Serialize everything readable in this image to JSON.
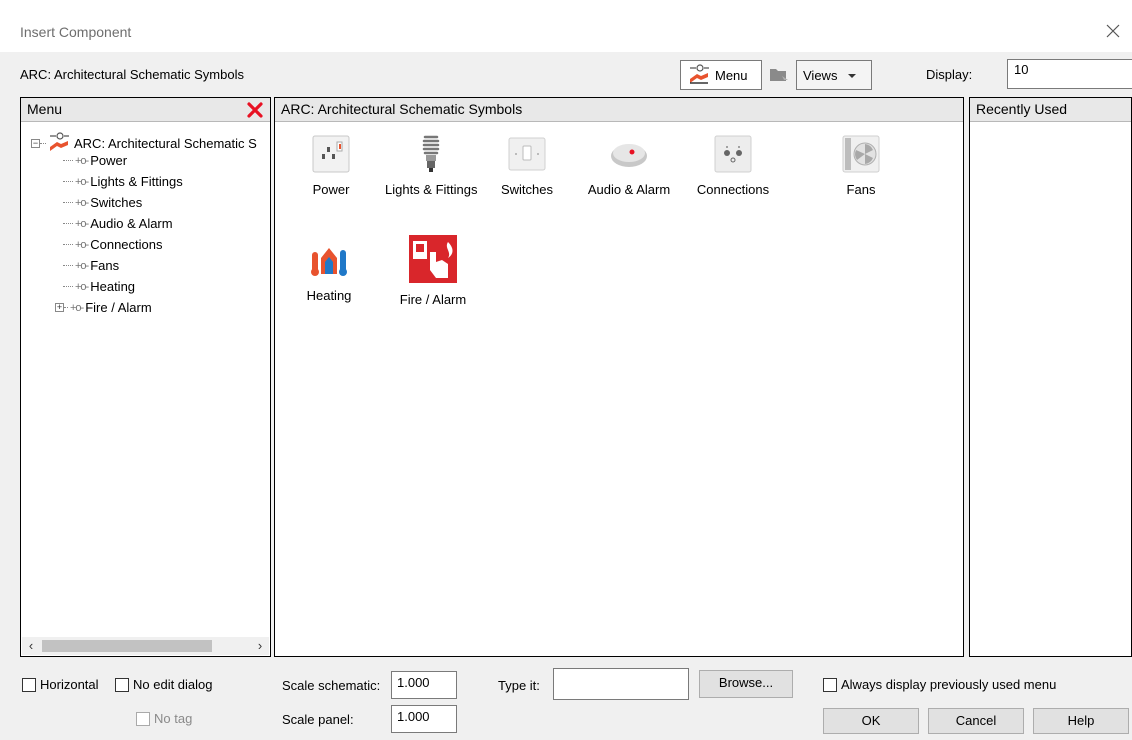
{
  "window": {
    "title": "Insert Component"
  },
  "header": {
    "library_label": "ARC: Architectural Schematic Symbols",
    "menu_button": "Menu",
    "views_button": "Views",
    "display_label": "Display:",
    "display_value": "10"
  },
  "left_panel": {
    "title": "Menu",
    "root_label": "ARC: Architectural Schematic S",
    "items": [
      {
        "label": "Power"
      },
      {
        "label": "Lights & Fittings"
      },
      {
        "label": "Switches"
      },
      {
        "label": "Audio & Alarm"
      },
      {
        "label": "Connections"
      },
      {
        "label": "Fans"
      },
      {
        "label": "Heating"
      },
      {
        "label": "Fire / Alarm",
        "expandable": true
      }
    ]
  },
  "center_panel": {
    "title": "ARC: Architectural Schematic Symbols",
    "icons": [
      {
        "label": "Power",
        "icon": "socket-icon"
      },
      {
        "label": "Lights & Fittings",
        "icon": "bulb-icon"
      },
      {
        "label": "Switches",
        "icon": "switch-icon"
      },
      {
        "label": "Audio & Alarm",
        "icon": "alarm-device-icon"
      },
      {
        "label": "Connections",
        "icon": "connection-plate-icon"
      },
      {
        "label": "Fans",
        "icon": "fan-icon"
      },
      {
        "label": "Heating",
        "icon": "heating-icon"
      },
      {
        "label": "Fire / Alarm",
        "icon": "fire-alarm-icon"
      }
    ]
  },
  "right_panel": {
    "title": "Recently Used"
  },
  "footer": {
    "horizontal": "Horizontal",
    "no_edit_dialog": "No edit dialog",
    "no_tag": "No tag",
    "scale_schematic_label": "Scale schematic:",
    "scale_schematic_value": "1.000",
    "scale_panel_label": "Scale panel:",
    "scale_panel_value": "1.000",
    "type_it_label": "Type it:",
    "type_it_value": "",
    "browse": "Browse...",
    "always_display": "Always display previously used menu",
    "ok": "OK",
    "cancel": "Cancel",
    "help": "Help"
  },
  "colors": {
    "delete_red": "#e81123",
    "fire_red": "#d9262b",
    "accent_orange": "#e8532e"
  }
}
